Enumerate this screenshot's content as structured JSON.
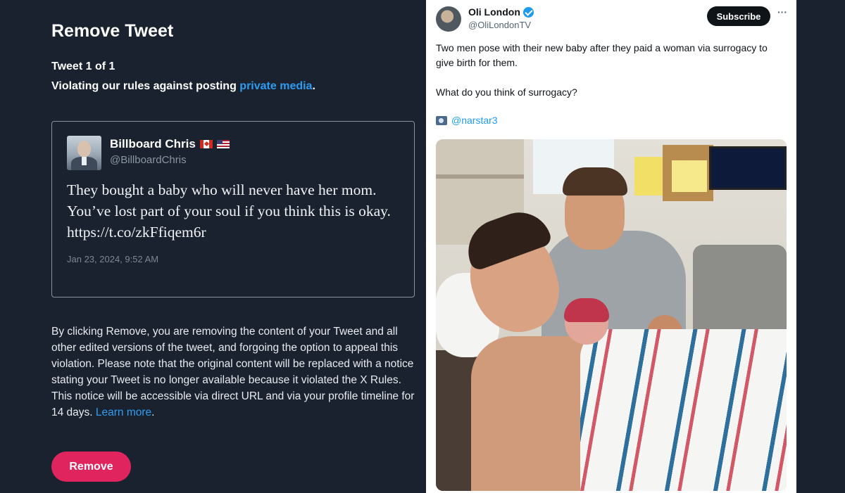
{
  "left_panel": {
    "title": "Remove Tweet",
    "tweet_count": "Tweet 1 of 1",
    "reason_prefix": "Violating our rules against posting ",
    "reason_link": "private media",
    "reason_suffix": ".",
    "tweet": {
      "author_name": "Billboard Chris",
      "author_handle": "@BillboardChris",
      "text": "They bought a baby who will never have her mom. You’ve lost part of your soul if you think this is okay. https://t.co/zkFfiqem6r",
      "date": "Jan 23, 2024, 9:52 AM"
    },
    "notice_text": "By clicking Remove, you are removing the content of your Tweet and all other edited versions of the tweet, and forgoing the option to appeal this violation. Please note that the original content will be replaced with a notice stating your Tweet is no longer available because it violated the X Rules. This notice will be accessible via direct URL and via your profile timeline for 14 days. ",
    "notice_link": "Learn more",
    "notice_suffix": ".",
    "remove_button": "Remove"
  },
  "right_panel": {
    "author_name": "Oli London",
    "author_handle": "@OliLondonTV",
    "subscribe_button": "Subscribe",
    "more_label": "···",
    "text_line1": "Two men pose with their new baby after they paid a woman via surrogacy to give birth for them.",
    "text_line2": "What do you think of surrogacy?",
    "photo_credit": "@narstar3"
  },
  "colors": {
    "left_bg": "#1a2230",
    "link": "#2e9cf0",
    "remove_button": "#e0245e",
    "verified": "#1d9bf0"
  },
  "icons": [
    "flag-canada-icon",
    "flag-usa-icon",
    "verified-badge-icon",
    "more-options-icon",
    "camera-icon"
  ]
}
